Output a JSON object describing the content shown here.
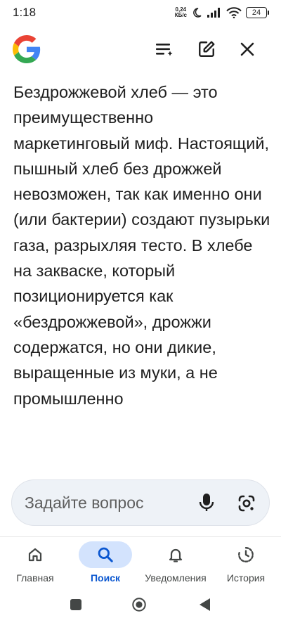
{
  "status_bar": {
    "time": "1:18",
    "net_speed_value": "0,24",
    "net_speed_unit": "КБ/с",
    "battery": "24",
    "icons": [
      "moon-icon",
      "signal-icon",
      "wifi-icon",
      "battery-icon"
    ]
  },
  "header": {
    "logo": "google-g-logo",
    "actions": [
      "history-list-icon",
      "edit-icon",
      "close-icon"
    ]
  },
  "answer": {
    "text": "Бездрожжевой хлеб — это преимущественно маркетинговый миф. Настоящий, пышный хлеб без дрожжей невозможен, так как именно они (или бактерии) создают пузырьки газа, разрыхляя тесто. В хлебе на закваске, который позиционируется как «бездрожжевой», дрожжи содержатся, но они дикие, выращенные из муки, а не промышленно"
  },
  "ask_bar": {
    "placeholder": "Задайте вопрос"
  },
  "bottom_nav": {
    "items": [
      {
        "label": "Главная",
        "icon": "home-icon",
        "active": false
      },
      {
        "label": "Поиск",
        "icon": "search-icon",
        "active": true
      },
      {
        "label": "Уведомления",
        "icon": "bell-icon",
        "active": false
      },
      {
        "label": "История",
        "icon": "history-icon",
        "active": false
      }
    ]
  },
  "colors": {
    "accent": "#0b57d0",
    "active_pill": "#d3e3fd",
    "ask_bar_bg": "#eef2f7",
    "text": "#1f1f1f"
  }
}
